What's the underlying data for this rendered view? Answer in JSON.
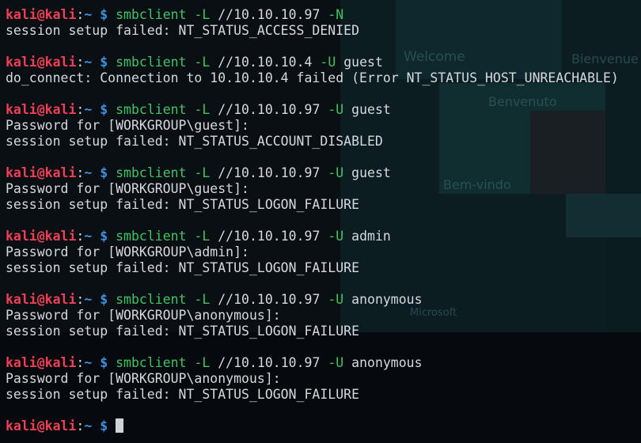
{
  "prompt": {
    "user": "kali@kali",
    "colon": ":",
    "path": "~",
    "symbol": "$"
  },
  "entries": [
    {
      "command": "smbclient",
      "target": "//10.10.10.97",
      "flag_l": "-L",
      "flag_u": "-N",
      "user_arg": "",
      "output": [
        "session setup failed: NT_STATUS_ACCESS_DENIED"
      ]
    },
    {
      "command": "smbclient",
      "target": "//10.10.10.4",
      "flag_l": "-L",
      "flag_u": "-U",
      "user_arg": "guest",
      "output": [
        "do_connect: Connection to 10.10.10.4 failed (Error NT_STATUS_HOST_UNREACHABLE)"
      ]
    },
    {
      "command": "smbclient",
      "target": "//10.10.10.97",
      "flag_l": "-L",
      "flag_u": "-U",
      "user_arg": "guest",
      "output": [
        "Password for [WORKGROUP\\guest]:",
        "session setup failed: NT_STATUS_ACCOUNT_DISABLED"
      ]
    },
    {
      "command": "smbclient",
      "target": "//10.10.10.97",
      "flag_l": "-L",
      "flag_u": "-U",
      "user_arg": "guest",
      "output": [
        "Password for [WORKGROUP\\guest]:",
        "session setup failed: NT_STATUS_LOGON_FAILURE"
      ]
    },
    {
      "command": "smbclient",
      "target": "//10.10.10.97",
      "flag_l": "-L",
      "flag_u": "-U",
      "user_arg": "admin",
      "output": [
        "Password for [WORKGROUP\\admin]:",
        "session setup failed: NT_STATUS_LOGON_FAILURE"
      ]
    },
    {
      "command": "smbclient",
      "target": "//10.10.10.97",
      "flag_l": "-L",
      "flag_u": "-U",
      "user_arg": "anonymous",
      "output": [
        "Password for [WORKGROUP\\anonymous]:",
        "session setup failed: NT_STATUS_LOGON_FAILURE"
      ]
    },
    {
      "command": "smbclient",
      "target": "//10.10.10.97",
      "flag_l": "-L",
      "flag_u": "-U",
      "user_arg": "anonymous",
      "output": [
        "Password for [WORKGROUP\\anonymous]:",
        "session setup failed: NT_STATUS_LOGON_FAILURE"
      ]
    }
  ],
  "background_text": {
    "welcome": "Welcome",
    "bienvenue": "Bienvenue",
    "benvenuto": "Benvenuto",
    "bem_vindo": "Bem-vindo",
    "microsoft": "Microsoft"
  },
  "colors": {
    "background": "#0a0f14",
    "user": "#ef4055",
    "path": "#3e8fe0",
    "command": "#42c465",
    "text": "#d6d9dc"
  }
}
